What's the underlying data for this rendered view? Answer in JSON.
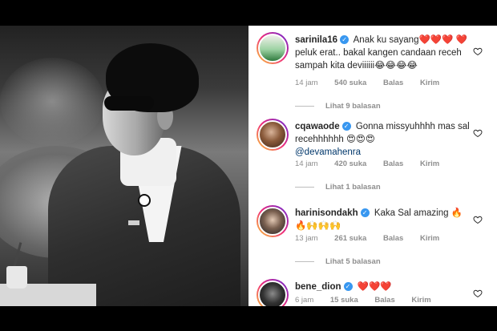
{
  "photo": {
    "description_icon": "person-photo"
  },
  "comments": [
    {
      "username": "sarinila16",
      "text_parts": [
        "Anak ku sayang",
        "❤️❤️❤️",
        "❤️ peluk erat.. bakal kangen candaan receh sampah kita deviiiiii😂😂😂😂"
      ],
      "time": "14 jam",
      "likes": "540 suka",
      "reply_label": "Balas",
      "send_label": "Kirim",
      "view_replies": "Lihat 9 balasan"
    },
    {
      "username": "cqawaode",
      "text_parts": [
        "Gonna missyuhhhh mas sal recehhhhhh 😍😍😍",
        "@devamahenra"
      ],
      "time": "14 jam",
      "likes": "420 suka",
      "reply_label": "Balas",
      "send_label": "Kirim",
      "view_replies": "Lihat 1 balasan"
    },
    {
      "username": "harinisondakh",
      "text_parts": [
        "Kaka Sal amazing 🔥🔥🙌🙌🙌"
      ],
      "time": "13 jam",
      "likes": "261 suka",
      "reply_label": "Balas",
      "send_label": "Kirim",
      "view_replies": "Lihat 5 balasan"
    },
    {
      "username": "bene_dion",
      "text_parts": [
        "❤️❤️❤️"
      ],
      "time": "6 jam",
      "likes": "15 suka",
      "reply_label": "Balas",
      "send_label": "Kirim"
    }
  ],
  "colors": {
    "accent": "#3897f0",
    "heart": "#ed4956",
    "muted": "#8e8e8e"
  }
}
